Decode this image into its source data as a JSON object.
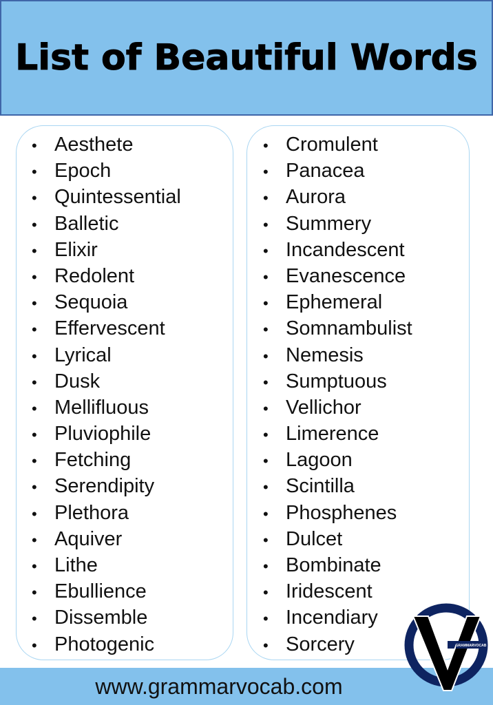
{
  "header": {
    "title": "List of Beautiful Words"
  },
  "bullet": "•",
  "columns": [
    {
      "words": [
        "Aesthete",
        "Epoch",
        "Quintessential",
        "Balletic",
        "Elixir",
        "Redolent",
        "Sequoia",
        "Effervescent",
        "Lyrical",
        "Dusk",
        "Mellifluous",
        "Pluviophile",
        "Fetching",
        "Serendipity",
        "Plethora",
        "Aquiver",
        "Lithe",
        "Ebullience",
        "Dissemble",
        "Photogenic"
      ]
    },
    {
      "words": [
        "Cromulent",
        "Panacea",
        "Aurora",
        "Summery",
        "Incandescent",
        "Evanescence",
        "Ephemeral",
        "Somnambulist",
        "Nemesis",
        "Sumptuous",
        "Vellichor",
        "Limerence",
        "Lagoon",
        "Scintilla",
        "Phosphenes",
        "Dulcet",
        "Bombinate",
        "Iridescent",
        "Incendiary",
        "Sorcery"
      ]
    }
  ],
  "footer": {
    "url": "www.grammarvocab.com"
  },
  "logo": {
    "label": "GRAMMARVOCAB",
    "ring_color": "#0e2461",
    "v_color": "#000000"
  },
  "colors": {
    "header_bg": "#83c1ec",
    "header_border": "#3f66a8",
    "box_border": "#a9d6f2"
  }
}
